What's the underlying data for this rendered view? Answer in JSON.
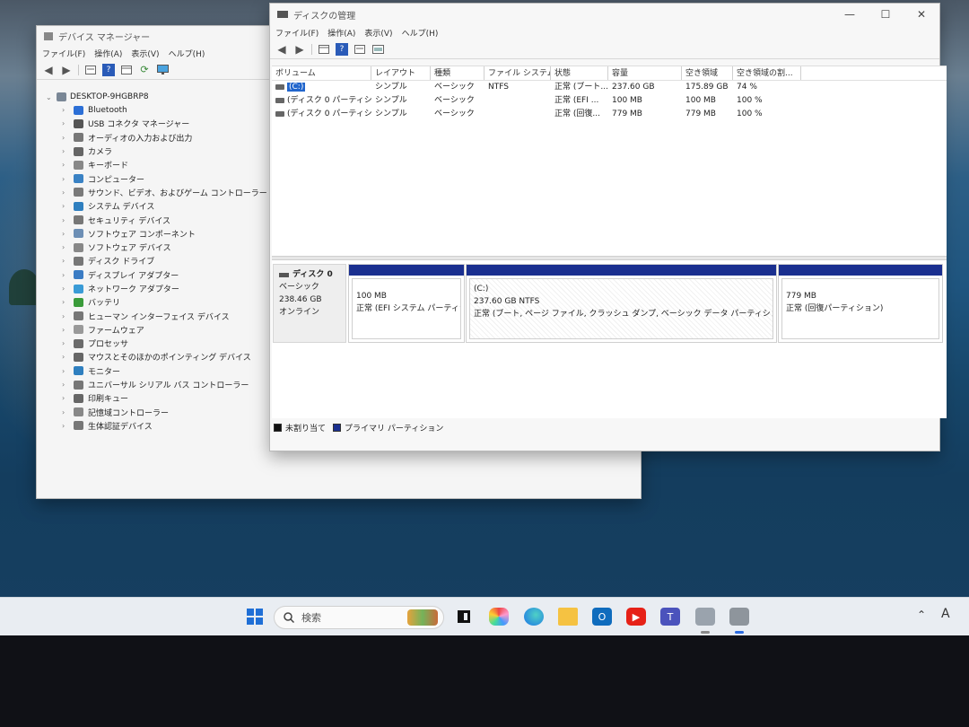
{
  "device_manager": {
    "title": "デバイス マネージャー",
    "menu": [
      "ファイル(F)",
      "操作(A)",
      "表示(V)",
      "ヘルプ(H)"
    ],
    "root": "DESKTOP-9HGBRP8",
    "items": [
      "Bluetooth",
      "USB コネクタ マネージャー",
      "オーディオの入力および出力",
      "カメラ",
      "キーボード",
      "コンピューター",
      "サウンド、ビデオ、およびゲーム コントローラー",
      "システム デバイス",
      "セキュリティ デバイス",
      "ソフトウェア コンポーネント",
      "ソフトウェア デバイス",
      "ディスク ドライブ",
      "ディスプレイ アダプター",
      "ネットワーク アダプター",
      "バッテリ",
      "ヒューマン インターフェイス デバイス",
      "ファームウェア",
      "プロセッサ",
      "マウスとそのほかのポインティング デバイス",
      "モニター",
      "ユニバーサル シリアル バス コントローラー",
      "印刷キュー",
      "記憶域コントローラー",
      "生体認証デバイス"
    ]
  },
  "disk_management": {
    "title": "ディスクの管理",
    "menu": [
      "ファイル(F)",
      "操作(A)",
      "表示(V)",
      "ヘルプ(H)"
    ],
    "columns": [
      "ボリューム",
      "レイアウト",
      "種類",
      "ファイル システム",
      "状態",
      "容量",
      "空き領域",
      "空き領域の割..."
    ],
    "rows": [
      [
        "(C:)",
        "シンプル",
        "ベーシック",
        "NTFS",
        "正常 (ブート...",
        "237.60 GB",
        "175.89 GB",
        "74 %"
      ],
      [
        "(ディスク 0 パーティショ...",
        "シンプル",
        "ベーシック",
        "",
        "正常 (EFI ...",
        "100 MB",
        "100 MB",
        "100 %"
      ],
      [
        "(ディスク 0 パーティショ...",
        "シンプル",
        "ベーシック",
        "",
        "正常 (回復...",
        "779 MB",
        "779 MB",
        "100 %"
      ]
    ],
    "disk": {
      "name": "ディスク 0",
      "type": "ベーシック",
      "size": "238.46 GB",
      "status": "オンライン"
    },
    "partitions": [
      {
        "line1": "100 MB",
        "line2": "正常 (EFI システム パーティショ"
      },
      {
        "line0": "(C:)",
        "line1": "237.60 GB NTFS",
        "line2": "正常 (ブート, ページ ファイル, クラッシュ ダンプ, ベーシック データ パーティション)"
      },
      {
        "line1": "779 MB",
        "line2": "正常 (回復パーティション)"
      }
    ],
    "legend": {
      "unallocated": "未割り当て",
      "primary": "プライマリ パーティション",
      "unallocated_color": "#111111",
      "primary_color": "#1a2f8f"
    }
  },
  "taskbar": {
    "search_placeholder": "検索",
    "icons": [
      "windows-start-icon",
      "search-icon",
      "task-view-icon",
      "copilot-icon",
      "edge-icon",
      "file-explorer-icon",
      "outlook-icon",
      "youtube-icon",
      "teams-icon",
      "device-manager-icon",
      "disk-management-icon"
    ],
    "tray_letter": "A"
  }
}
